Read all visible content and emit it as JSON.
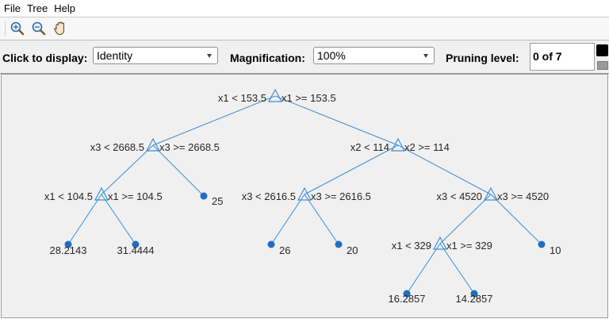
{
  "menu": {
    "items": [
      "File",
      "Tree",
      "Help"
    ]
  },
  "toolbar": {
    "icons": [
      "zoom-in-icon",
      "zoom-out-icon",
      "pan-hand-icon"
    ]
  },
  "controls": {
    "display_label": "Click to display:",
    "display_value": "Identity",
    "magnification_label": "Magnification:",
    "magnification_value": "100%",
    "pruning_label": "Pruning level:",
    "pruning_value": "0 of 7"
  },
  "colors": {
    "tree": "#3c8ed6",
    "leaf": "#1f6fc0",
    "text": "#262626"
  },
  "tree": {
    "branches": [
      {
        "id": "n1",
        "left_rule": "x1 < 153.5",
        "right_rule": "x1 >= 153.5"
      },
      {
        "id": "n2",
        "left_rule": "x3 < 2668.5",
        "right_rule": "x3 >= 2668.5"
      },
      {
        "id": "n3",
        "left_rule": "x2 < 114",
        "right_rule": "x2 >= 114"
      },
      {
        "id": "n4",
        "left_rule": "x1 < 104.5",
        "right_rule": "x1 >= 104.5"
      },
      {
        "id": "n5",
        "left_rule": "x3 < 2616.5",
        "right_rule": "x3 >= 2616.5"
      },
      {
        "id": "n6",
        "left_rule": "x3 < 4520",
        "right_rule": "x3 >= 4520"
      },
      {
        "id": "n7",
        "left_rule": "x1 < 329",
        "right_rule": "x1 >= 329"
      }
    ],
    "leaves": [
      {
        "id": "l1",
        "value": "28.2143"
      },
      {
        "id": "l2",
        "value": "31.4444"
      },
      {
        "id": "l3",
        "value": "25"
      },
      {
        "id": "l4",
        "value": "26"
      },
      {
        "id": "l5",
        "value": "20"
      },
      {
        "id": "l6",
        "value": "10"
      },
      {
        "id": "l7",
        "value": "16.2857"
      },
      {
        "id": "l8",
        "value": "14.2857"
      }
    ]
  }
}
